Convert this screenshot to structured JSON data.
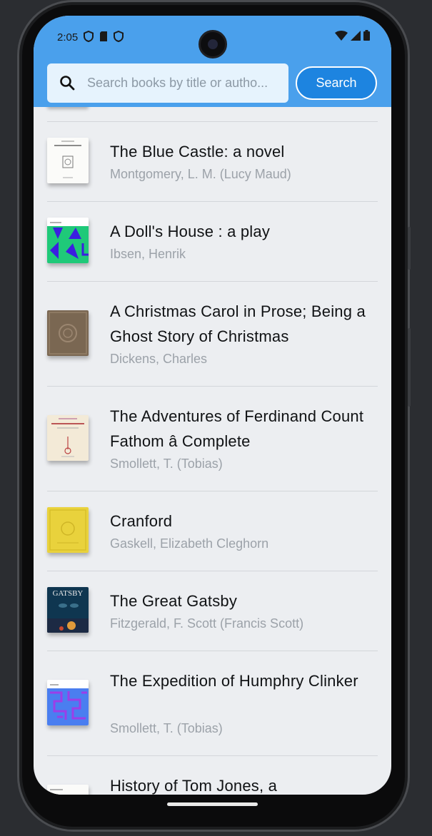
{
  "status": {
    "time": "2:05"
  },
  "search": {
    "placeholder": "Search books by title or autho...",
    "value": "",
    "button_label": "Search"
  },
  "colors": {
    "accent": "#1d84e0",
    "bar": "#4aa0ec",
    "background": "#eceef1"
  },
  "books": [
    {
      "title": "The Blue Castle: a novel",
      "author": "Montgomery, L. M. (Lucy Maud)",
      "cover": "white-title-page"
    },
    {
      "title": "A Doll's House : a play",
      "author": "Ibsen, Henrik",
      "cover": "green-blue-pattern"
    },
    {
      "title": "A Christmas Carol in Prose; Being a Ghost Story of Christmas",
      "author": "Dickens, Charles",
      "cover": "brown-cloth"
    },
    {
      "title": "The Adventures of Ferdinand Count Fathom â Complete",
      "author": "Smollett, T. (Tobias)",
      "cover": "cream-title-page"
    },
    {
      "title": "Cranford",
      "author": "Gaskell, Elizabeth Cleghorn",
      "cover": "yellow-ornate"
    },
    {
      "title": "The Great Gatsby",
      "author": "Fitzgerald, F. Scott (Francis Scott)",
      "cover": "gatsby-art"
    },
    {
      "title": "The Expedition of Humphry Clinker",
      "author": "Smollett, T. (Tobias)",
      "cover": "blue-purple-pattern"
    },
    {
      "title": "History of Tom Jones, a",
      "author": "",
      "cover": "white-title-page"
    }
  ]
}
